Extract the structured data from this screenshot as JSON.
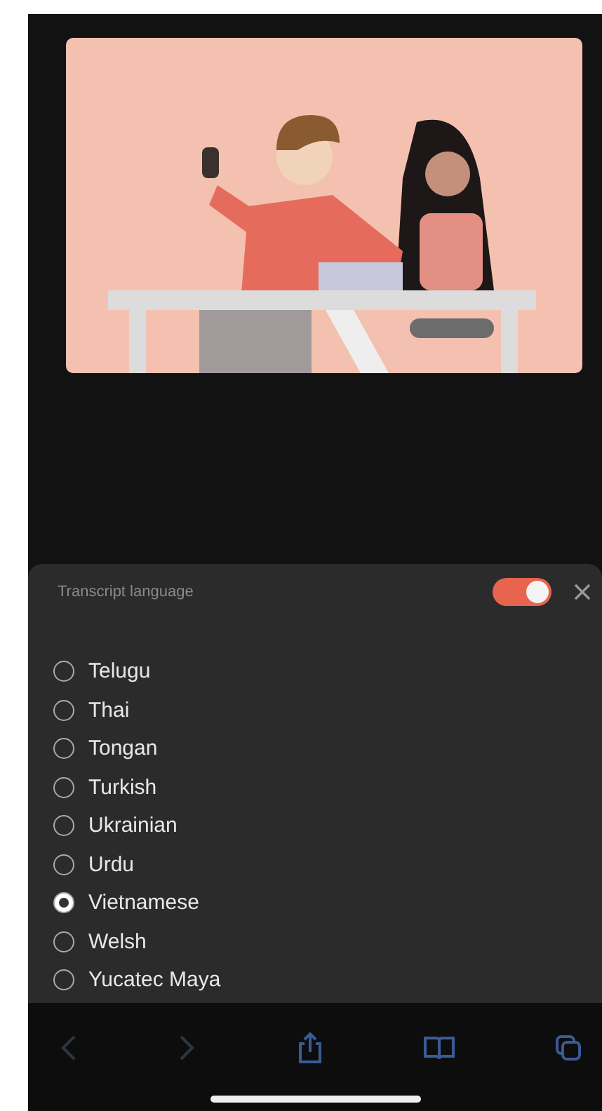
{
  "panel": {
    "title": "Transcript language",
    "toggle": {
      "on": true
    },
    "languages": [
      {
        "label": "Telugu",
        "selected": false
      },
      {
        "label": "Thai",
        "selected": false
      },
      {
        "label": "Tongan",
        "selected": false
      },
      {
        "label": "Turkish",
        "selected": false
      },
      {
        "label": "Ukrainian",
        "selected": false
      },
      {
        "label": "Urdu",
        "selected": false
      },
      {
        "label": "Vietnamese",
        "selected": true
      },
      {
        "label": "Welsh",
        "selected": false
      },
      {
        "label": "Yucatec Maya",
        "selected": false
      }
    ]
  },
  "toolbar": {
    "back": {
      "disabled": true
    },
    "forward": {
      "disabled": true
    }
  }
}
